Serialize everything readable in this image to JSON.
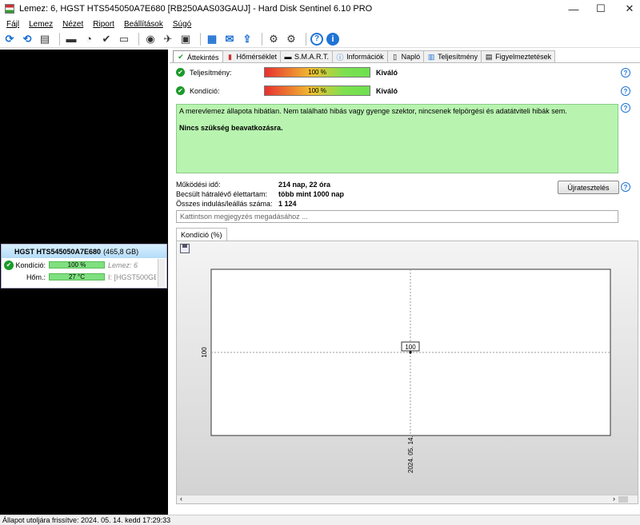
{
  "window": {
    "title": "Lemez: 6, HGST HTS545050A7E680 [RB250AAS03GAUJ]  -  Hard Disk Sentinel 6.10 PRO",
    "minimize": "—",
    "maximize": "☐",
    "close": "✕"
  },
  "menu": [
    "Fájl",
    "Lemez",
    "Nézet",
    "Riport",
    "Beállítások",
    "Súgó"
  ],
  "disk_card": {
    "name": "HGST HTS545050A7E680",
    "size": "(465,8 GB)",
    "condition_label": "Kondíció:",
    "condition_value": "100 %",
    "condition_extra": "Lemez: 6",
    "temp_label": "Hőm.:",
    "temp_value": "27 °C",
    "temp_extra": "I: [HGST500GB-B"
  },
  "tabs": [
    "Áttekintés",
    "Hőmérséklet",
    "S.M.A.R.T.",
    "Információk",
    "Napló",
    "Teljesítmény",
    "Figyelmeztetések"
  ],
  "metrics": {
    "performance_label": "Teljesítmény:",
    "performance_value": "100 %",
    "performance_rating": "Kiváló",
    "condition_label": "Kondíció:",
    "condition_value": "100 %",
    "condition_rating": "Kiváló"
  },
  "status_message": "A merevlemez állapota hibátlan. Nem található hibás vagy gyenge szektor, nincsenek felpörgési és adatátviteli hibák sem.",
  "status_action": "Nincs szükség beavatkozásra.",
  "info": [
    {
      "label": "Működési idő:",
      "value": "214 nap, 22 óra"
    },
    {
      "label": "Becsült hátralévő élettartam:",
      "value": "több mint 1000 nap"
    },
    {
      "label": "Összes indulás/leállás száma:",
      "value": "1 124"
    }
  ],
  "reset_button": "Újratesztelés",
  "note_placeholder": "Kattintson megjegyzés megadásához ...",
  "chart_tab": "Kondíció  (%)",
  "chart_data": {
    "type": "line",
    "x": [
      "2024. 05. 14."
    ],
    "y": [
      100
    ],
    "data_labels": [
      "100"
    ],
    "ytick": "100",
    "xtick": "2024. 05. 14."
  },
  "statusbar": "Állapot utoljára frissítve: 2024. 05. 14. kedd 17:29:33"
}
